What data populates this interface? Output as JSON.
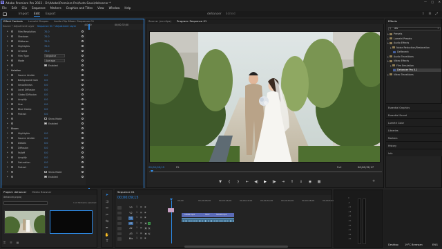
{
  "titlebar": {
    "title": "Adobe Premiere Pro 2022 - D:\\Adobe\\Premiere Pro\\Auto-Save\\dehancer *",
    "logo": "Pr"
  },
  "menu": [
    "File",
    "Edit",
    "Clip",
    "Sequence",
    "Markers",
    "Graphics and Titles",
    "View",
    "Window",
    "Help"
  ],
  "workspace": {
    "tabs": [
      "Import",
      "Edit",
      "Export"
    ],
    "active": "Edit",
    "project": "dehancer",
    "project_status": "Edited"
  },
  "effect_controls": {
    "tabs": [
      "Effect Controls",
      "Lumetri Scopes",
      "Audio Clip Mixer: Sequence 01"
    ],
    "source_label": "Source • Adjustment Layer",
    "sequence_label": "Sequence 01 • Adjustment Layer",
    "timecode_top": ";00;00",
    "timecode_right": "00;00;32;00",
    "current_time": "00;00;09;15",
    "rows": [
      {
        "type": "param",
        "name": "Film Resolution",
        "value": "70.0"
      },
      {
        "type": "param",
        "name": "Shadows",
        "value": "70.0"
      },
      {
        "type": "param",
        "name": "Midtones",
        "value": "70.0"
      },
      {
        "type": "param",
        "name": "Highlights",
        "value": "70.0"
      },
      {
        "type": "param",
        "name": "Chroma",
        "value": "70.0"
      },
      {
        "type": "select",
        "name": "Film Type",
        "value": "Negative"
      },
      {
        "type": "select",
        "name": "Mode",
        "value": "Average"
      },
      {
        "type": "check",
        "name": "",
        "value": "Enabled",
        "on": true
      },
      {
        "type": "header",
        "name": "Halation"
      },
      {
        "type": "param",
        "name": "Source Limiter",
        "value": "0.0"
      },
      {
        "type": "param",
        "name": "Background Gain",
        "value": "0.0"
      },
      {
        "type": "param",
        "name": "Smoothness",
        "value": "0.0"
      },
      {
        "type": "param",
        "name": "Local Diffusion",
        "value": "0.0"
      },
      {
        "type": "param",
        "name": "Global Diffusion",
        "value": "0.0"
      },
      {
        "type": "param",
        "name": "Amplify",
        "value": "0.0"
      },
      {
        "type": "param",
        "name": "Hue",
        "value": "0.0"
      },
      {
        "type": "param",
        "name": "Blue Clamp",
        "value": "0.0"
      },
      {
        "type": "param",
        "name": "Protect",
        "value": "0.0"
      },
      {
        "type": "check",
        "name": "",
        "value": "Show Mode",
        "on": false
      },
      {
        "type": "check",
        "name": "",
        "value": "Enabled",
        "on": true
      },
      {
        "type": "header",
        "name": "Bloom"
      },
      {
        "type": "param",
        "name": "Highlights",
        "value": "0.0"
      },
      {
        "type": "param",
        "name": "Source Limiter",
        "value": "0.0"
      },
      {
        "type": "param",
        "name": "Details",
        "value": "0.0"
      },
      {
        "type": "param",
        "name": "Diffusion",
        "value": "0.0"
      },
      {
        "type": "param",
        "name": "Falloff",
        "value": "0.0"
      },
      {
        "type": "param",
        "name": "Amplify",
        "value": "0.0"
      },
      {
        "type": "param",
        "name": "Saturation",
        "value": "0.0"
      },
      {
        "type": "param",
        "name": "Protect",
        "value": "0.0"
      },
      {
        "type": "check",
        "name": "",
        "value": "Show Mode",
        "on": false
      },
      {
        "type": "check",
        "name": "",
        "value": "Enabled",
        "on": true
      }
    ]
  },
  "program_monitor": {
    "tabs": [
      "Source: (no clips)",
      "Program: Sequence 01"
    ],
    "timecode": "00;00;09;15",
    "fit": "Fit",
    "resolution": "Full",
    "duration": "00;00;32;17"
  },
  "effects_panel": {
    "title": "Effects",
    "search": "dfo",
    "tree": [
      {
        "label": "Presets",
        "kind": "folder",
        "indent": 0
      },
      {
        "label": "Lumetri Presets",
        "kind": "folder",
        "indent": 0
      },
      {
        "label": "Audio Effects",
        "kind": "folder",
        "indent": 0
      },
      {
        "label": "Noise Reduction/Restoration",
        "kind": "folder",
        "indent": 1
      },
      {
        "label": "DeReverb",
        "kind": "fx",
        "indent": 2
      },
      {
        "label": "Audio Transitions",
        "kind": "folder",
        "indent": 0
      },
      {
        "label": "Video Effects",
        "kind": "folder",
        "indent": 0
      },
      {
        "label": "Film Emulation",
        "kind": "folder",
        "indent": 1
      },
      {
        "label": "Dehancer Pro 5.1",
        "kind": "fx",
        "indent": 2,
        "selected": true
      },
      {
        "label": "Video Transitions",
        "kind": "folder",
        "indent": 0
      }
    ],
    "groups": [
      "Essential Graphics",
      "Essential Sound",
      "Lumetri Color",
      "Libraries",
      "Markers",
      "History",
      "Info"
    ]
  },
  "project_panel": {
    "tabs": [
      "Project: dehancer",
      "Media Browser"
    ],
    "path": "dehancer.prproj",
    "count": "1 of 30 items selected"
  },
  "timeline": {
    "tab": "Sequence 01",
    "timecode": "00;00;09;15",
    "ruler": [
      "00;00",
      "00;00;08;00",
      "00;00;16;00",
      "00;00;24;00",
      "00;00;32;00",
      "00;00;40;00",
      "00;00;48;00",
      "00;00;56;00"
    ],
    "tracks": [
      {
        "name": "V3",
        "on": false
      },
      {
        "name": "V2",
        "on": false
      },
      {
        "name": "V1",
        "on": true
      },
      {
        "name": "A1",
        "on": true
      },
      {
        "name": "A2",
        "on": false
      },
      {
        "name": "A3",
        "on": false
      },
      {
        "name": "Mix",
        "on": false
      }
    ],
    "clips_v": [
      "5306K.mp4",
      "5307",
      "5404D.mp4"
    ]
  },
  "meter": {
    "scale": [
      "0",
      "-6",
      "-12",
      "-18",
      "-24",
      "-30",
      "-36",
      "-42",
      "-48",
      "-54"
    ]
  },
  "taskbar": {
    "desktop": "Desktop",
    "weather": "19°C  Berawan",
    "lang": "ENG"
  },
  "colors": {
    "accent": "#2d8ceb",
    "video_clip": "#5b6bb8",
    "adjustment_clip": "#c9a1c5",
    "audio_clip": "#3d6a8a"
  }
}
